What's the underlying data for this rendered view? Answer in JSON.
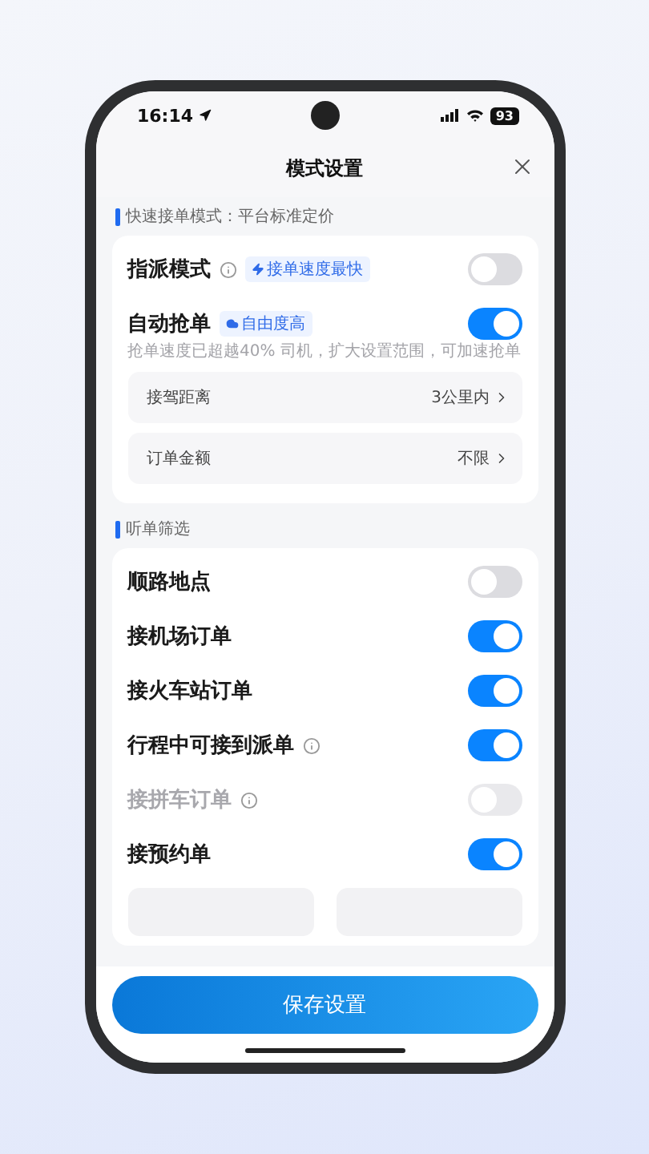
{
  "status_bar": {
    "time": "16:14",
    "battery": "93"
  },
  "header": {
    "title": "模式设置"
  },
  "sections": [
    {
      "title": "快速接单模式：平台标准定价",
      "items": [
        {
          "kind": "toggle",
          "label": "指派模式",
          "info": true,
          "tag": {
            "text": "接单速度最快"
          },
          "on": false,
          "disabled": false
        },
        {
          "kind": "toggle",
          "label": "自动抢单",
          "info": false,
          "tag": {
            "text": "自由度高"
          },
          "on": true,
          "disabled": false,
          "note": "抢单速度已超越40% 司机，扩大设置范围，可加速抢单"
        },
        {
          "kind": "link",
          "label": "接驾距离",
          "value": "3公里内"
        },
        {
          "kind": "link",
          "label": "订单金额",
          "value": "不限"
        }
      ]
    },
    {
      "title": "听单筛选",
      "items": [
        {
          "kind": "toggle",
          "label": "顺路地点",
          "info": false,
          "on": false,
          "disabled": false
        },
        {
          "kind": "toggle",
          "label": "接机场订单",
          "info": false,
          "on": true,
          "disabled": false
        },
        {
          "kind": "toggle",
          "label": "接火车站订单",
          "info": false,
          "on": true,
          "disabled": false
        },
        {
          "kind": "toggle",
          "label": "行程中可接到派单",
          "info": true,
          "on": true,
          "disabled": false
        },
        {
          "kind": "toggle",
          "label": "接拼车订单",
          "info": true,
          "on": false,
          "disabled": true
        },
        {
          "kind": "toggle",
          "label": "接预约单",
          "info": false,
          "on": true,
          "disabled": false
        },
        {
          "kind": "range"
        }
      ]
    }
  ],
  "save_button": "保存设置"
}
